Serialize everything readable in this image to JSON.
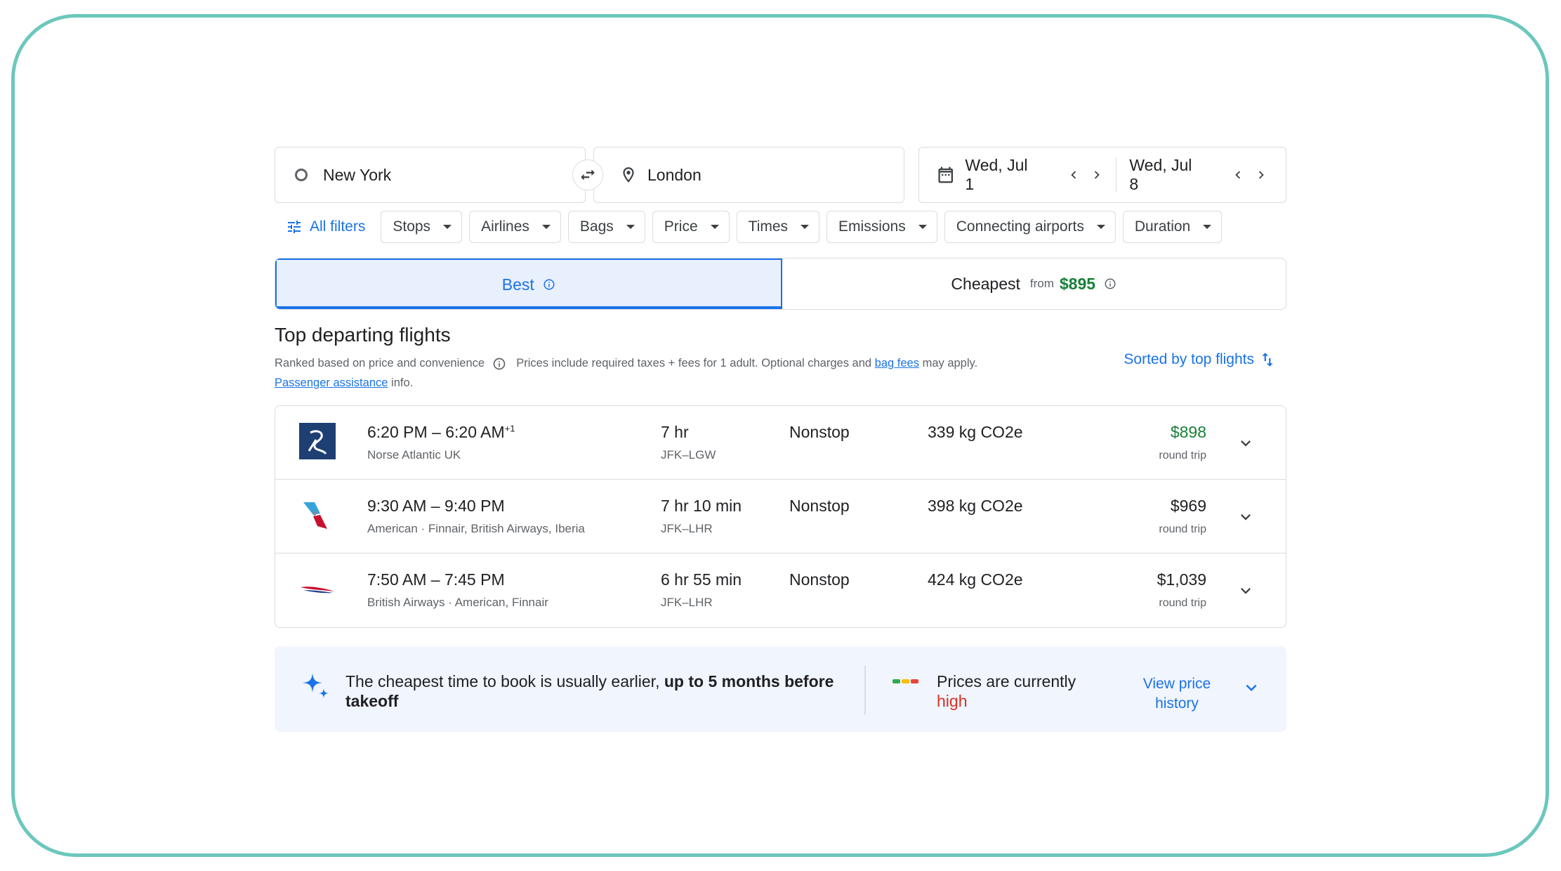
{
  "search": {
    "origin": "New York",
    "destination": "London",
    "depart_date": "Wed, Jul 1",
    "return_date": "Wed, Jul 8"
  },
  "filters": {
    "all_filters_label": "All filters",
    "chips": [
      "Stops",
      "Airlines",
      "Bags",
      "Price",
      "Times",
      "Emissions",
      "Connecting airports",
      "Duration"
    ]
  },
  "tabs": {
    "best_label": "Best",
    "cheapest_label": "Cheapest",
    "cheapest_from": "from",
    "cheapest_price": "$895"
  },
  "results": {
    "heading": "Top departing flights",
    "subtext_ranked": "Ranked based on price and convenience",
    "subtext_prices": "Prices include required taxes + fees for 1 adult. Optional charges and",
    "bag_fees_link": "bag fees",
    "subtext_may_apply": "may apply.",
    "passenger_link": "Passenger assistance",
    "subtext_info": "info.",
    "sorted_label": "Sorted by top flights"
  },
  "flights": [
    {
      "times": "6:20 PM – 6:20 AM",
      "day_offset": "+1",
      "airline": "Norse Atlantic UK",
      "duration": "7 hr",
      "route": "JFK–LGW",
      "stops": "Nonstop",
      "emissions": "339 kg CO2e",
      "price": "$898",
      "price_note": "round trip"
    },
    {
      "times": "9:30 AM – 9:40 PM",
      "day_offset": "",
      "airline": "American · Finnair, British Airways, Iberia",
      "duration": "7 hr 10 min",
      "route": "JFK–LHR",
      "stops": "Nonstop",
      "emissions": "398 kg CO2e",
      "price": "$969",
      "price_note": "round trip"
    },
    {
      "times": "7:50 AM – 7:45 PM",
      "day_offset": "",
      "airline": "British Airways · American, Finnair",
      "duration": "6 hr 55 min",
      "route": "JFK–LHR",
      "stops": "Nonstop",
      "emissions": "424 kg CO2e",
      "price": "$1,039",
      "price_note": "round trip"
    }
  ],
  "insight": {
    "tip_prefix": "The cheapest time to book is usually earlier,",
    "tip_bold": "up to 5 months before takeoff",
    "price_status_prefix": "Prices are currently",
    "price_status_value": "high",
    "view_history_label": "View price history"
  },
  "colors": {
    "accent": "#1a73e8",
    "good_price": "#188038",
    "high_price": "#d93025",
    "frame_border": "#6cc7bd"
  }
}
